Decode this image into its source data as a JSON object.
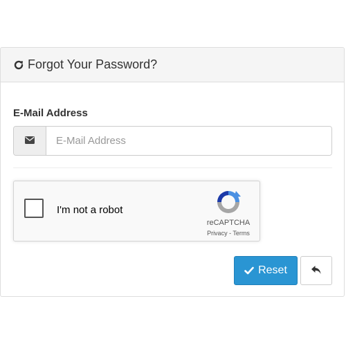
{
  "panel": {
    "title": "Forgot Your Password?",
    "title_icon": "refresh-icon"
  },
  "form": {
    "email_label": "E-Mail Address",
    "email_icon": "envelope-icon",
    "email_placeholder": "E-Mail Address",
    "email_value": ""
  },
  "recaptcha": {
    "checkbox_label": "I'm not a robot",
    "checked": false,
    "brand": "reCAPTCHA",
    "privacy_link": "Privacy",
    "separator": " - ",
    "terms_link": "Terms",
    "logo_icon": "recaptcha-logo-icon"
  },
  "actions": {
    "reset_label": "Reset",
    "reset_icon": "check-icon",
    "back_icon": "reply-icon"
  },
  "colors": {
    "primary": "#2a95d3",
    "heading_bg": "#f5f5f5",
    "border": "#dddddd"
  }
}
